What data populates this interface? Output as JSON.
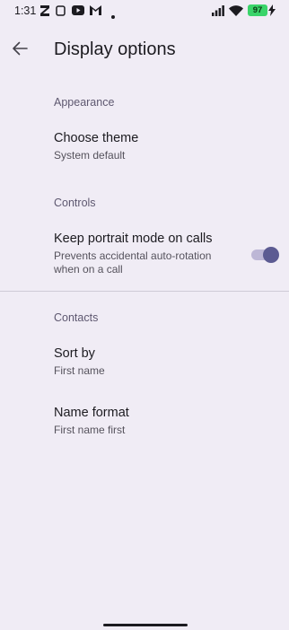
{
  "status_bar": {
    "time": "1:31",
    "battery_level": "97",
    "icons": [
      "notification-z-icon",
      "copy-icon",
      "youtube-icon",
      "gmail-icon",
      "dot-icon",
      "signal-icon",
      "wifi-icon",
      "battery-icon",
      "charging-bolt-icon"
    ]
  },
  "app_bar": {
    "back_icon": "arrow-back-icon",
    "title": "Display options"
  },
  "sections": {
    "appearance": {
      "header": "Appearance",
      "theme": {
        "title": "Choose theme",
        "summary": "System default"
      }
    },
    "controls": {
      "header": "Controls",
      "portrait": {
        "title": "Keep portrait mode on calls",
        "summary_line1": "Prevents accidental auto-rotation",
        "summary_line2": "when on a call",
        "enabled": true
      }
    },
    "contacts": {
      "header": "Contacts",
      "sort": {
        "title": "Sort by",
        "summary": "First name"
      },
      "format": {
        "title": "Name format",
        "summary": "First name first"
      }
    }
  },
  "colors": {
    "background": "#f0ecf5",
    "switch_thumb": "#5c5b92",
    "switch_track": "#bdb7d6",
    "battery": "#3ad46a"
  }
}
